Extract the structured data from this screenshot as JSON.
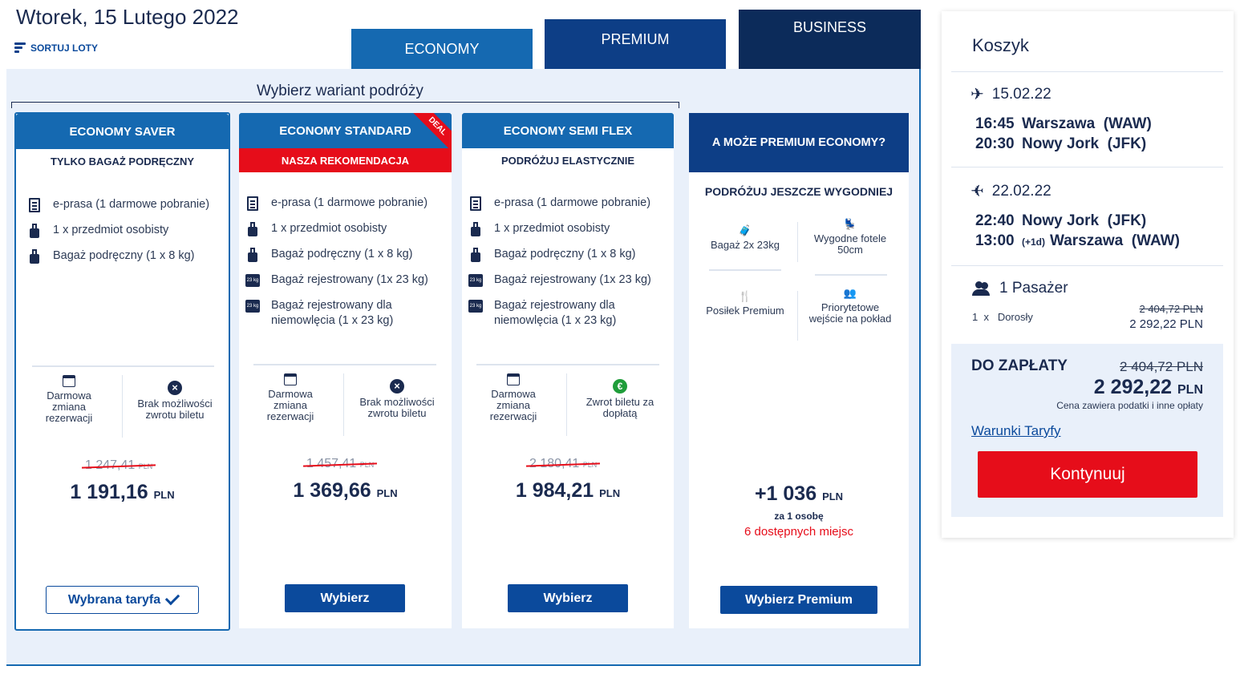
{
  "header": {
    "date": "Wtorek, 15 Lutego 2022",
    "sort_label": "SORTUJ LOTY",
    "icons": {
      "sort": "sort-icon"
    }
  },
  "cabin_tabs": [
    {
      "label": "ECONOMY",
      "selected": true
    },
    {
      "label": "PREMIUM",
      "selected": false
    },
    {
      "label": "BUSINESS",
      "selected": false
    }
  ],
  "variant_title": "Wybierz wariant podróży",
  "fares": [
    {
      "name": "ECONOMY SAVER",
      "subtitle": "TYLKO BAGAŻ PODRĘCZNY",
      "features": [
        "e-prasa (1 darmowe pobranie)",
        "1 x przedmiot osobisty",
        "Bagaż podręczny (1 x 8 kg)"
      ],
      "options": [
        {
          "icon": "calendar-icon",
          "label": "Darmowa zmiana rezerwacji"
        },
        {
          "icon": "x-circle-icon",
          "label": "Brak możliwości zwrotu biletu"
        }
      ],
      "old_price": "1 247,41",
      "old_currency": "PLN",
      "price": "1 191,16",
      "currency": "PLN",
      "button": "Wybrana taryfa",
      "selected": true
    },
    {
      "name": "ECONOMY STANDARD",
      "badge": "DEAL",
      "subtitle": "NASZA REKOMENDACJA",
      "features": [
        "e-prasa (1 darmowe pobranie)",
        "1 x przedmiot osobisty",
        "Bagaż podręczny (1 x 8 kg)",
        "Bagaż rejestrowany (1x 23 kg)",
        "Bagaż rejestrowany dla niemowlęcia (1 x 23 kg)"
      ],
      "options": [
        {
          "icon": "calendar-icon",
          "label": "Darmowa zmiana rezerwacji"
        },
        {
          "icon": "x-circle-icon",
          "label": "Brak możliwości zwrotu biletu"
        }
      ],
      "old_price": "1 457,41",
      "old_currency": "PLN",
      "price": "1 369,66",
      "currency": "PLN",
      "button": "Wybierz"
    },
    {
      "name": "ECONOMY SEMI FLEX",
      "subtitle": "PODRÓŻUJ ELASTYCZNIE",
      "features": [
        "e-prasa (1 darmowe pobranie)",
        "1 x przedmiot osobisty",
        "Bagaż podręczny (1 x 8 kg)",
        "Bagaż rejestrowany (1x 23 kg)",
        "Bagaż rejestrowany dla niemowlęcia (1 x 23 kg)"
      ],
      "options": [
        {
          "icon": "calendar-icon",
          "label": "Darmowa zmiana rezerwacji"
        },
        {
          "icon": "euro-circle-icon",
          "label": "Zwrot biletu za dopłatą"
        }
      ],
      "old_price": "2 180,41",
      "old_currency": "PLN",
      "price": "1 984,21",
      "currency": "PLN",
      "button": "Wybierz"
    }
  ],
  "feature_icon_labels": {
    "suitcase": "23 kg"
  },
  "premium_upsell": {
    "title": "A MOŻE PREMIUM ECONOMY?",
    "subtitle": "PODRÓŻUJ JESZCZE WYGODNIEJ",
    "features": [
      {
        "icon": "suitcase-icon",
        "label": "Bagaż 2x 23kg"
      },
      {
        "icon": "seat-icon",
        "label": "Wygodne fotele 50cm"
      },
      {
        "icon": "meal-icon",
        "label": "Posiłek Premium"
      },
      {
        "icon": "priority-boarding-icon",
        "label": "Priorytetowe wejście na pokład"
      }
    ],
    "price": "+1 036",
    "currency": "PLN",
    "per": "za 1 osobę",
    "seats": "6 dostępnych miejsc",
    "button": "Wybierz Premium"
  },
  "cart": {
    "title": "Koszyk",
    "outbound": {
      "date": "15.02.22",
      "lines": [
        {
          "time": "16:45",
          "city": "Warszawa",
          "code": "(WAW)"
        },
        {
          "time": "20:30",
          "city": "Nowy Jork",
          "code": "(JFK)"
        }
      ]
    },
    "inbound": {
      "date": "22.02.22",
      "lines": [
        {
          "time": "22:40",
          "city": "Nowy Jork",
          "code": "(JFK)",
          "plus": ""
        },
        {
          "time": "13:00",
          "city": "Warszawa",
          "code": "(WAW)",
          "plus": "(+1d)"
        }
      ]
    },
    "passengers": {
      "label": "1 Pasażer",
      "count": "1",
      "x": "x",
      "type": "Dorosły",
      "old_price": "2 404,72 PLN",
      "price": "2 292,22 PLN"
    },
    "payment": {
      "label": "DO ZAPŁATY",
      "old_total": "2 404,72 PLN",
      "total": "2 292,22",
      "currency": "PLN",
      "note": "Cena zawiera podatki i inne opłaty",
      "fare_link": "Warunki Taryfy",
      "button": "Kontynuuj"
    }
  }
}
